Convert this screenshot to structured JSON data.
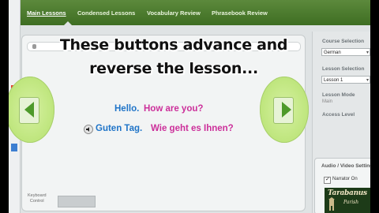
{
  "nav": {
    "tabs": [
      {
        "label": "Main Lessons",
        "active": true
      },
      {
        "label": "Condensed Lessons",
        "active": false
      },
      {
        "label": "Vocabulary Review",
        "active": false
      },
      {
        "label": "Phrasebook Review",
        "active": false
      }
    ]
  },
  "overlay": {
    "line1": "These buttons advance and",
    "line2": "reverse the lesson..."
  },
  "lesson": {
    "english_greeting": "Hello.",
    "english_question": "How are you?",
    "german_greeting": "Guten Tag.",
    "german_question": "Wie geht es Ihnen?",
    "keyboard_label_1": "Keyboard",
    "keyboard_label_2": "Control"
  },
  "sidebar": {
    "course_label": "Course Selection",
    "course_value": "German",
    "lesson_label": "Lesson Selection",
    "lesson_value": "Lesson 1",
    "mode_label": "Lesson Mode",
    "mode_value": "Main",
    "access_label": "Access Level"
  },
  "av": {
    "title": "Audio / Video Setting",
    "narrator_label": "Narrator On",
    "narrator_checked": true
  },
  "logo": {
    "line1": "Tarabanus",
    "line2": "Parish"
  },
  "colors": {
    "nav_green": "#4a7a2c",
    "button_green": "#c3e884",
    "arrow_green": "#4e9a2a",
    "english_blue": "#1f74c8",
    "pink": "#cc2f9a"
  }
}
